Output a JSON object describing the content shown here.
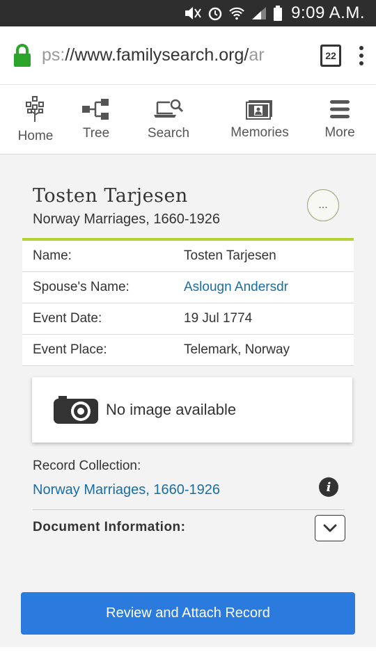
{
  "status_bar": {
    "time": "9:09 A.M.",
    "icons": [
      "mute-icon",
      "alarm-icon",
      "wifi-icon",
      "signal-icon",
      "battery-icon"
    ]
  },
  "browser": {
    "url_visible": "ps://www.familysearch.org/",
    "url_faded": "ar",
    "tab_count": "22",
    "secure_color": "#2aa52a"
  },
  "nav": {
    "items": [
      {
        "label": "Home",
        "icon": "tree-home-icon"
      },
      {
        "label": "Tree",
        "icon": "pedigree-icon"
      },
      {
        "label": "Search",
        "icon": "search-laptop-icon"
      },
      {
        "label": "Memories",
        "icon": "photo-icon"
      },
      {
        "label": "More",
        "icon": "hamburger-icon"
      }
    ]
  },
  "record": {
    "title": "Tosten Tarjesen",
    "subtitle": "Norway Marriages, 1660-1926",
    "more_label": "...",
    "fields": [
      {
        "label": "Name:",
        "value": "Tosten Tarjesen",
        "link": false
      },
      {
        "label": "Spouse's Name:",
        "value": "Aslougn Andersdr",
        "link": true
      },
      {
        "label": "Event Date:",
        "value": "19 Jul 1774",
        "link": false
      },
      {
        "label": "Event Place:",
        "value": "Telemark, Norway",
        "link": false
      }
    ],
    "no_image_text": "No image available",
    "collection_label": "Record Collection:",
    "collection_link": "Norway Marriages, 1660-1926",
    "info_glyph": "i",
    "document_label": "Document Information:"
  },
  "actions": {
    "review_button": "Review and Attach Record"
  },
  "colors": {
    "accent_green": "#b5d433",
    "link_blue": "#1a6da3",
    "button_blue": "#2b7ade"
  }
}
